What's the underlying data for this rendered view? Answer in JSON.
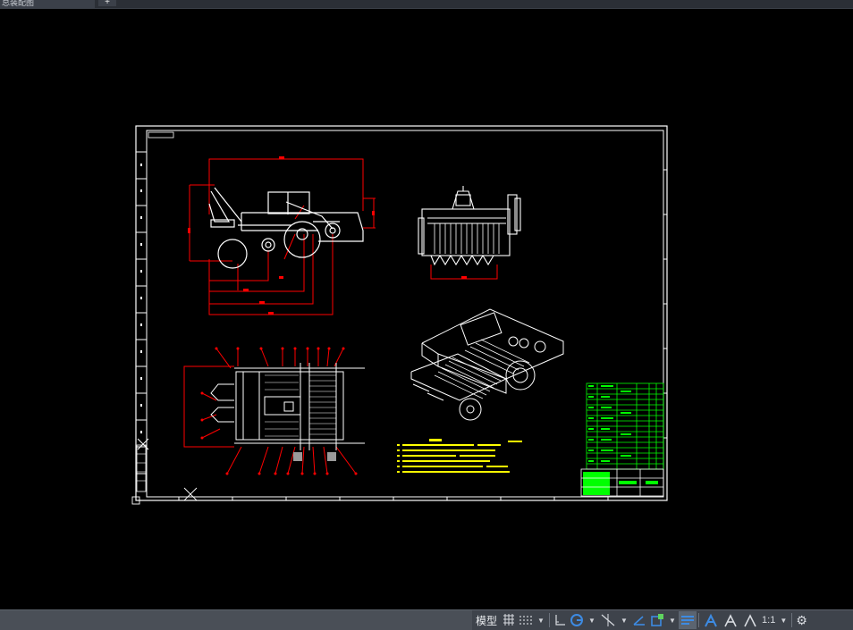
{
  "app": {
    "tab_title": "总装配图",
    "new_tab_icon": "plus-icon"
  },
  "drawing": {
    "background": "#000000",
    "colors": {
      "frame": "#ffffff",
      "dimension": "#ff0000",
      "text": "#ffff00",
      "bom": "#00ff00"
    }
  },
  "statusbar": {
    "model_label": "模型",
    "scale_label": "1:1",
    "items": [
      {
        "name": "grid-icon"
      },
      {
        "name": "snap-icon"
      },
      {
        "name": "ortho-icon"
      },
      {
        "name": "polar-tracking-icon"
      },
      {
        "name": "isodraft-icon"
      },
      {
        "name": "dynamic-ucs-icon"
      },
      {
        "name": "object-snap-icon"
      },
      {
        "name": "lineweight-icon"
      },
      {
        "name": "annotation-scale-icon"
      },
      {
        "name": "annotation-visibility-icon"
      },
      {
        "name": "autoscale-icon"
      },
      {
        "name": "settings-gear-icon"
      }
    ]
  }
}
